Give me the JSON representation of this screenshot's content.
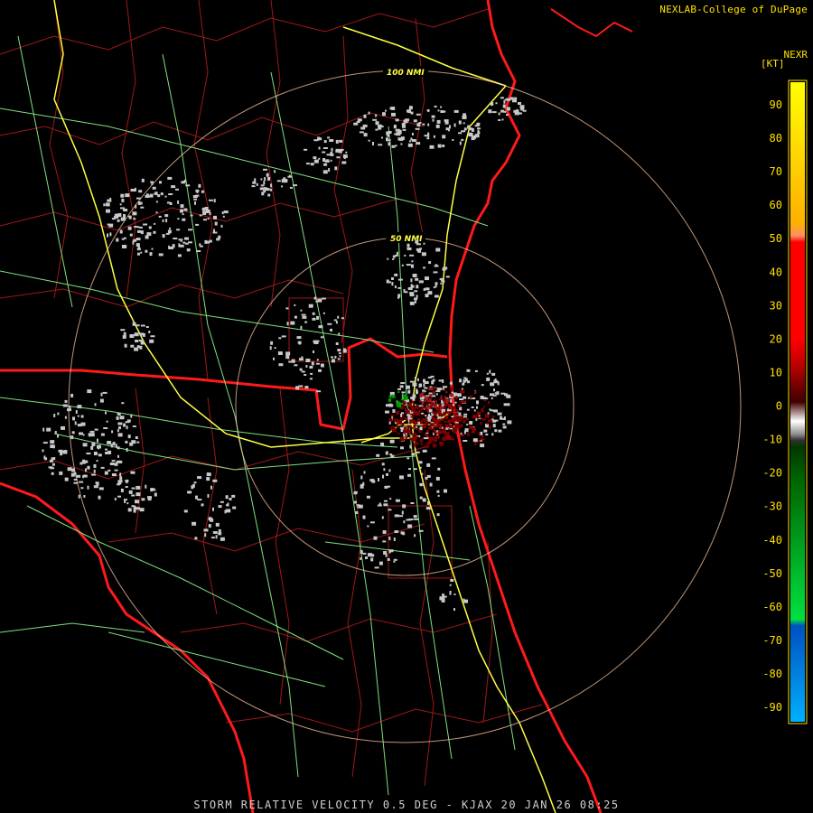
{
  "header": {
    "credit": "NEXLAB-College of DuPage",
    "product_code": "NEXR",
    "units": "[KT]"
  },
  "footer": {
    "caption": "STORM RELATIVE VELOCITY 0.5 DEG - KJAX 20 JAN 26 08:25"
  },
  "range_rings": [
    {
      "label": "50 NMI",
      "range_nmi": 50
    },
    {
      "label": "100 NMI",
      "range_nmi": 100
    }
  ],
  "legend": {
    "ticks": [
      "90",
      "80",
      "70",
      "60",
      "50",
      "40",
      "30",
      "20",
      "10",
      "0",
      "-10",
      "-20",
      "-30",
      "-40",
      "-50",
      "-60",
      "-70",
      "-80",
      "-90"
    ],
    "colors": {
      "outbound_high": "#ffff00",
      "outbound_mid": "#ff0000",
      "outbound_low": "#6a0000",
      "near_zero": "#c0c0c0",
      "inbound_low": "#006400",
      "inbound_mid": "#00e040",
      "inbound_high": "#00a0ff"
    }
  },
  "map_colors": {
    "coastline": "#ff1a1a",
    "county_lines": "#a01818",
    "interstates": "#ffff40",
    "highways": "#80e080",
    "range_rings": "#ffc8a0"
  }
}
